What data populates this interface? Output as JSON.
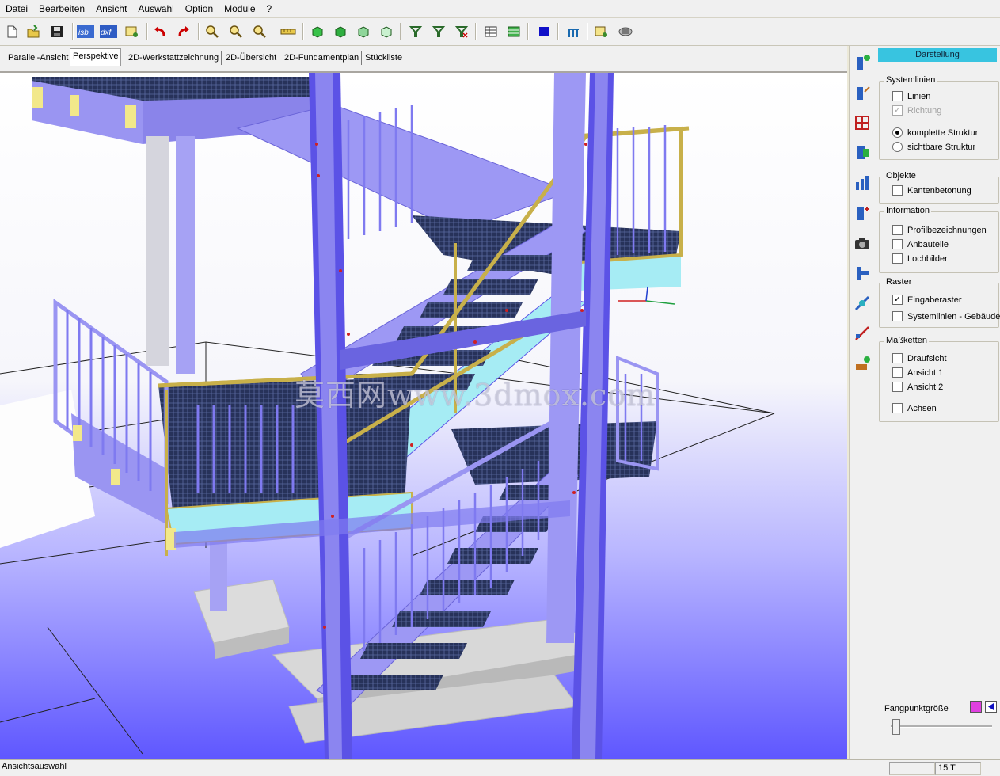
{
  "menu": [
    "Datei",
    "Bearbeiten",
    "Ansicht",
    "Auswahl",
    "Option",
    "Module",
    "?"
  ],
  "toolbar": {
    "isb_label": "isb",
    "dxf_label": "dxf",
    "icons": [
      "new-file-icon",
      "open-folder-icon",
      "save-disk-icon",
      "isb-export-icon",
      "dxf-export-icon",
      "print-preview-icon",
      "undo-arrow-icon",
      "redo-arrow-icon",
      "zoom-in-icon",
      "zoom-out-icon",
      "zoom-fit-icon",
      "measure-ruler-icon",
      "cube-view-1-icon",
      "cube-view-2-icon",
      "cube-view-3-icon",
      "cube-view-4-icon",
      "filter-1-icon",
      "filter-2-icon",
      "filter-3-icon",
      "grid-table-icon",
      "green-table-icon",
      "blue-square-icon",
      "structure-icon",
      "layer-icon",
      "render-icon"
    ]
  },
  "tabs": [
    "Parallel-Ansicht",
    "Perspektive",
    "2D-Werkstattzeichnung",
    "2D-Übersicht",
    "2D-Fundamentplan",
    "Stückliste"
  ],
  "active_tab": "Perspektive",
  "viewport": {
    "watermark": "莫西网www.3dmox.com",
    "colors": {
      "steel": "#9a95f2",
      "steel_dark": "#5b52e6",
      "rail_gold": "#c8b04a",
      "grating": "#27325a",
      "concrete": "#d3d3d3",
      "glass": "#a6ecf4"
    }
  },
  "vtoolbar_icons": [
    "column-add-icon",
    "column-edit-icon",
    "grid-frame-icon",
    "door-icon",
    "stairs-icon",
    "column-plus-icon",
    "camera-icon",
    "beam-icon",
    "connection-icon",
    "cross-brace-icon",
    "anchor-icon"
  ],
  "panel": {
    "title": "Darstellung",
    "systemlinien": {
      "label": "Systemlinien",
      "linien": "Linien",
      "richtung": "Richtung",
      "komplette": "komplette Struktur",
      "sichtbare": "sichtbare Struktur"
    },
    "objekte": {
      "label": "Objekte",
      "kanten": "Kantenbetonung"
    },
    "information": {
      "label": "Information",
      "profil": "Profilbezeichnungen",
      "anbau": "Anbauteile",
      "loch": "Lochbilder"
    },
    "raster": {
      "label": "Raster",
      "eingabe": "Eingaberaster",
      "gebaeude": "Systemlinien - Gebäude"
    },
    "masse": {
      "label": "Maßketten",
      "drauf": "Draufsicht",
      "ansicht1": "Ansicht 1",
      "ansicht2": "Ansicht 2",
      "achsen": "Achsen"
    },
    "fangpunkt": {
      "label": "Fangpunktgröße",
      "slider_value": 0.02,
      "color1": "#e040e0",
      "color2": "#1010c0"
    },
    "states": {
      "linien": false,
      "richtung": true,
      "komplette": true,
      "sichtbare": false,
      "kanten": false,
      "profil": false,
      "anbau": false,
      "loch": false,
      "eingabe": true,
      "gebaeude": false,
      "drauf": false,
      "ansicht1": false,
      "ansicht2": false,
      "achsen": false
    }
  },
  "status": {
    "left": "Ansichtsauswahl",
    "right": "15 T"
  }
}
